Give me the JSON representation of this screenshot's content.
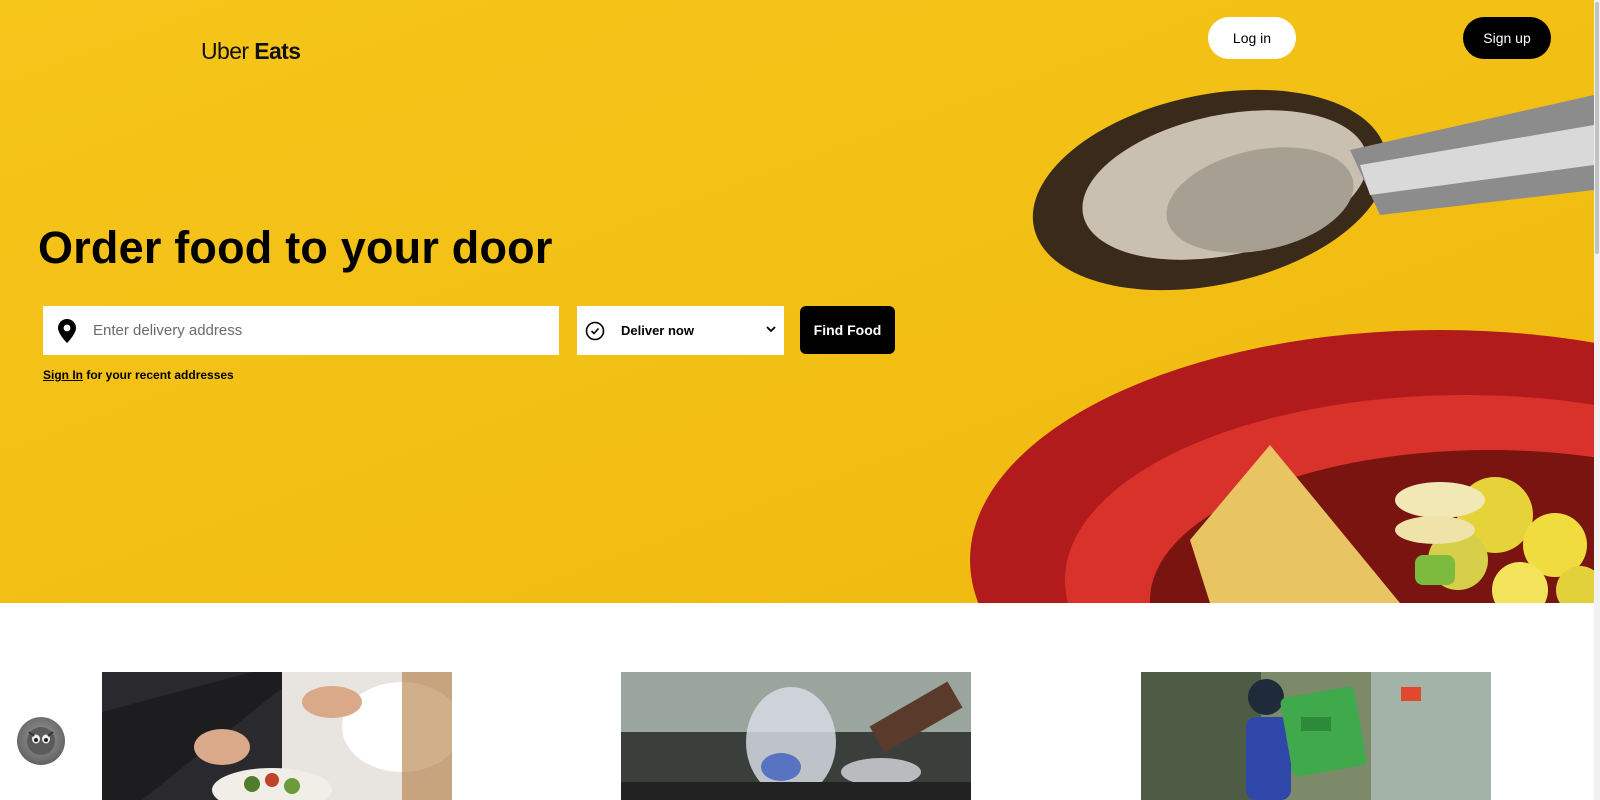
{
  "brand": {
    "logo_word1": "Uber",
    "logo_word2": "Eats"
  },
  "header": {
    "login_label": "Log in",
    "signup_label": "Sign up"
  },
  "hero": {
    "headline": "Order food to your door",
    "address_placeholder": "Enter delivery address",
    "address_value": "",
    "deliver_option": "Deliver now",
    "find_button": "Find Food",
    "signin_link": "Sign In",
    "signin_suffix": " for your recent addresses"
  },
  "cards": [
    {
      "image": "person-laptop-salad"
    },
    {
      "image": "chef-cooking-pan"
    },
    {
      "image": "courier-with-backpack"
    }
  ],
  "colors": {
    "hero_yellow": "#f4c11a",
    "black": "#000000",
    "white": "#ffffff"
  },
  "icons": {
    "location": "location-pin-icon",
    "clock": "clock-icon",
    "chevron": "chevron-down-icon",
    "chat": "chat-bubble-icon"
  }
}
